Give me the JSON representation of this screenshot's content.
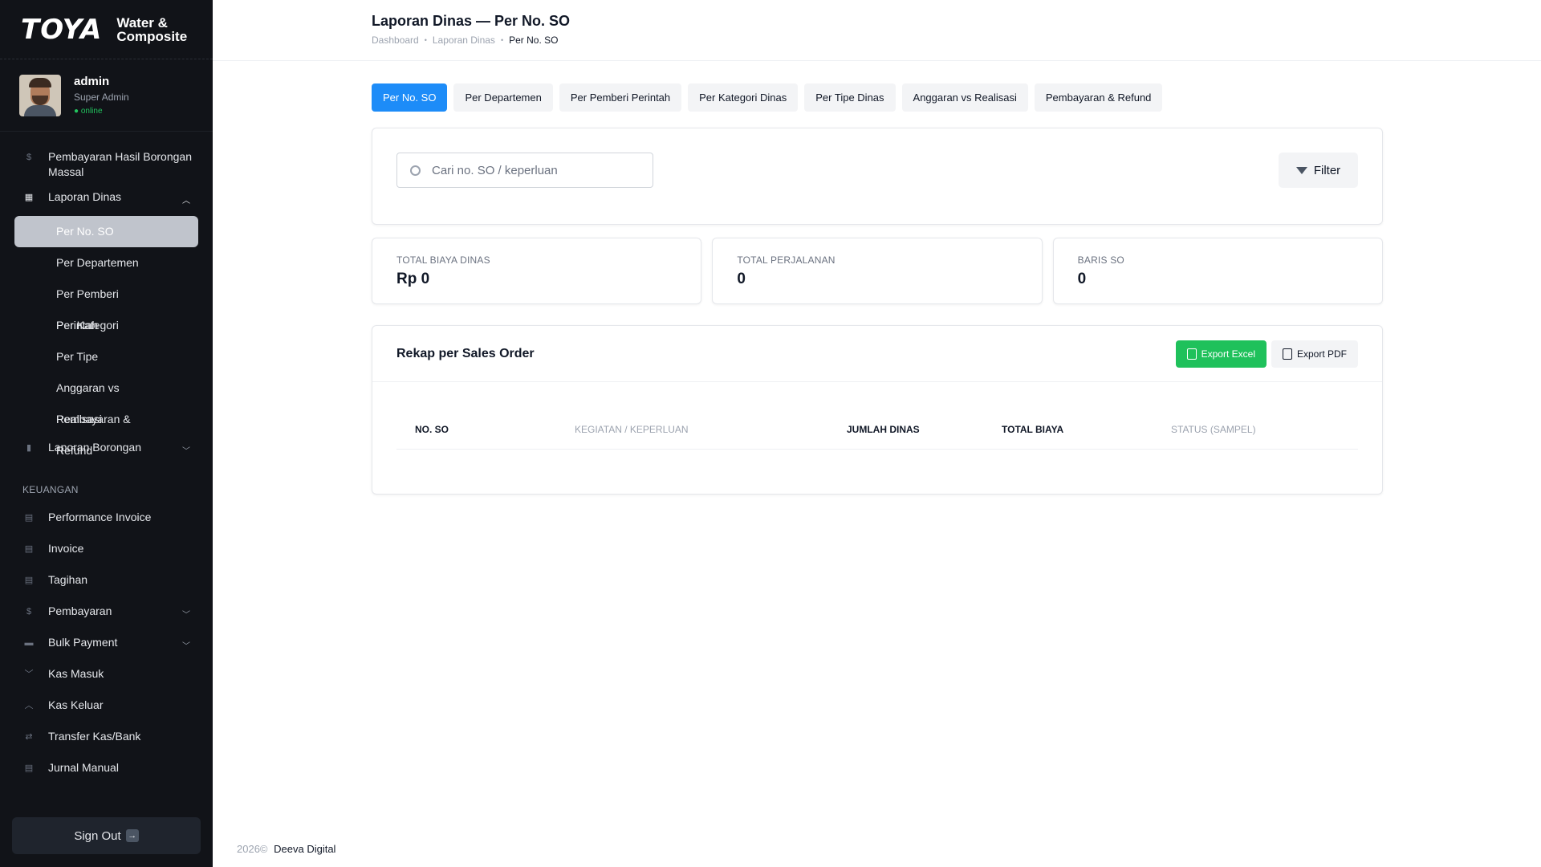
{
  "brand": {
    "name": "TOYA",
    "sub_line1": "Water &",
    "sub_line2": "Composite"
  },
  "user": {
    "name": "admin",
    "role": "Super Admin",
    "status": "● online"
  },
  "sidebar": {
    "items_top": [
      {
        "label": "Pembayaran Hasil Borongan Massal",
        "icon": "$"
      },
      {
        "label": "Laporan Dinas",
        "icon": "▦"
      }
    ],
    "laporan_dinas_sub": [
      {
        "label": "Per No. SO"
      },
      {
        "label": "Per Departemen"
      },
      {
        "label": "Per Pemberi Perintah"
      },
      {
        "label": "Per Kategori"
      },
      {
        "label": "Per Tipe"
      },
      {
        "label": "Anggaran vs Realisasi"
      },
      {
        "label": "Pembayaran & Refund"
      }
    ],
    "laporan_borongan": "Laporan Borongan",
    "section_keuangan": "KEUANGAN",
    "keuangan_items": [
      {
        "label": "Performance Invoice"
      },
      {
        "label": "Invoice"
      },
      {
        "label": "Tagihan"
      },
      {
        "label": "Pembayaran"
      },
      {
        "label": "Bulk Payment"
      },
      {
        "label": "Kas Masuk"
      },
      {
        "label": "Kas Keluar"
      },
      {
        "label": "Transfer Kas/Bank"
      },
      {
        "label": "Jurnal Manual"
      }
    ],
    "signout": "Sign Out"
  },
  "header": {
    "title": "Laporan Dinas — Per No. SO",
    "breadcrumb": [
      "Dashboard",
      "Laporan Dinas",
      "Per No. SO"
    ]
  },
  "tabs": [
    {
      "label": "Per No. SO"
    },
    {
      "label": "Per Departemen"
    },
    {
      "label": "Per Pemberi Perintah"
    },
    {
      "label": "Per Kategori Dinas"
    },
    {
      "label": "Per Tipe Dinas"
    },
    {
      "label": "Anggaran vs Realisasi"
    },
    {
      "label": "Pembayaran & Refund"
    }
  ],
  "search": {
    "placeholder": "Cari no. SO / keperluan",
    "value": ""
  },
  "filter_label": "Filter",
  "stats": [
    {
      "label": "TOTAL BIAYA DINAS",
      "value": "Rp 0"
    },
    {
      "label": "TOTAL PERJALANAN",
      "value": "0"
    },
    {
      "label": "BARIS SO",
      "value": "0"
    }
  ],
  "table": {
    "title": "Rekap per Sales Order",
    "export_excel": "Export Excel",
    "export_pdf": "Export PDF",
    "columns": [
      "NO. SO",
      "KEGIATAN / KEPERLUAN",
      "JUMLAH DINAS",
      "TOTAL BIAYA",
      "STATUS (SAMPEL)"
    ]
  },
  "footer": {
    "year": "2026©",
    "company": "Deeva Digital"
  },
  "colors": {
    "sidebar_bg": "#111318",
    "accent_blue": "#1d8cf8",
    "export_green": "#1fc15b",
    "online_green": "#22c55e"
  }
}
